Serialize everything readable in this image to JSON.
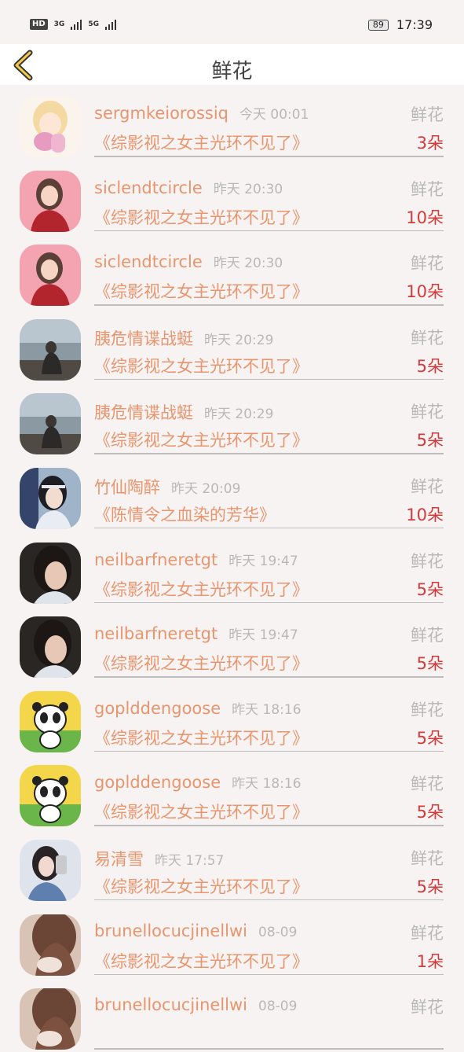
{
  "status_bar": {
    "hd": "HD",
    "sim1": "3G",
    "sim2": "5G",
    "battery": "89",
    "time": "17:39"
  },
  "header": {
    "title": "鲜花",
    "back_icon": "chevron-left-icon"
  },
  "gift_label": "鲜花",
  "rows": [
    {
      "user": "sergmkeiorossiq",
      "time": "今天 00:01",
      "book": "《综影视之女主光环不见了》",
      "count": "3朵",
      "avatar": "anime"
    },
    {
      "user": "siclendtcircle",
      "time": "昨天 20:30",
      "book": "《综影视之女主光环不见了》",
      "count": "10朵",
      "avatar": "pink"
    },
    {
      "user": "siclendtcircle",
      "time": "昨天 20:30",
      "book": "《综影视之女主光环不见了》",
      "count": "10朵",
      "avatar": "pink"
    },
    {
      "user": "胰危情谍战蜓",
      "time": "昨天 20:29",
      "book": "《综影视之女主光环不见了》",
      "count": "5朵",
      "avatar": "sea"
    },
    {
      "user": "胰危情谍战蜓",
      "time": "昨天 20:29",
      "book": "《综影视之女主光环不见了》",
      "count": "5朵",
      "avatar": "sea"
    },
    {
      "user": "竹仙陶醉",
      "time": "昨天 20:09",
      "book": "《陈情令之血染的芳华》",
      "count": "10朵",
      "avatar": "drama"
    },
    {
      "user": "neilbarfneretgt",
      "time": "昨天 19:47",
      "book": "《综影视之女主光环不见了》",
      "count": "5朵",
      "avatar": "girl"
    },
    {
      "user": "neilbarfneretgt",
      "time": "昨天 19:47",
      "book": "《综影视之女主光环不见了》",
      "count": "5朵",
      "avatar": "girl"
    },
    {
      "user": "goplddengoose",
      "time": "昨天 18:16",
      "book": "《综影视之女主光环不见了》",
      "count": "5朵",
      "avatar": "panda"
    },
    {
      "user": "goplddengoose",
      "time": "昨天 18:16",
      "book": "《综影视之女主光环不见了》",
      "count": "5朵",
      "avatar": "panda"
    },
    {
      "user": "易清雪",
      "time": "昨天 17:57",
      "book": "《综影视之女主光环不见了》",
      "count": "5朵",
      "avatar": "selfie"
    },
    {
      "user": "brunellocucjinellwi",
      "time": "08-09",
      "book": "《综影视之女主光环不见了》",
      "count": "1朵",
      "avatar": "hair"
    },
    {
      "user": "brunellocucjinellwi",
      "time": "08-09",
      "book": "",
      "count": "",
      "avatar": "hair"
    }
  ]
}
